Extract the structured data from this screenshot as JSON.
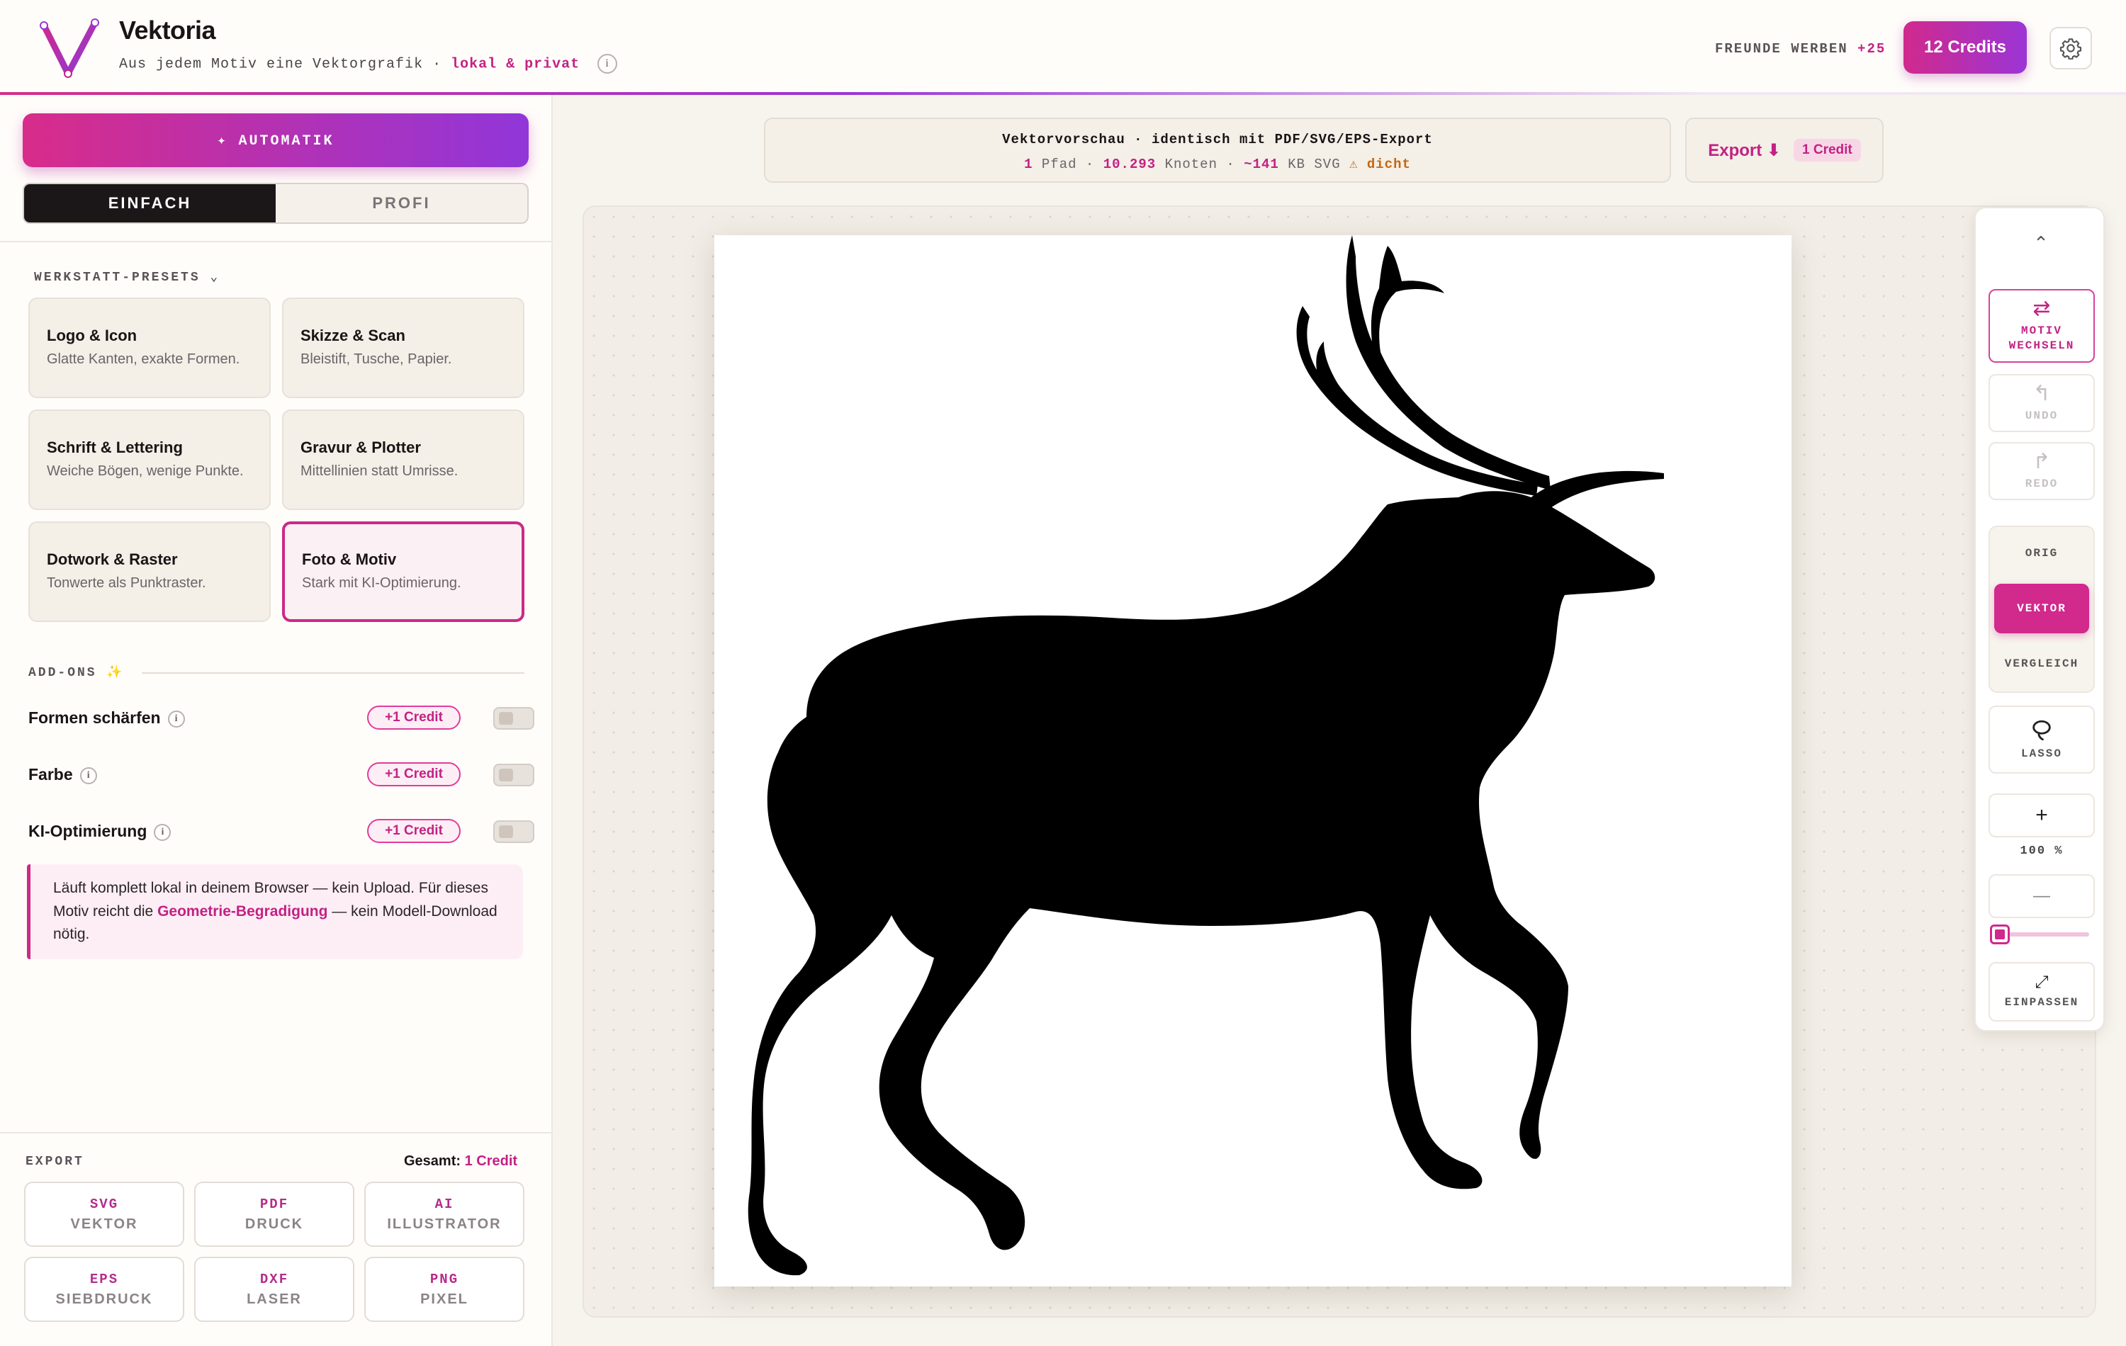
{
  "header": {
    "app_title": "Vektoria",
    "subtitle_prefix": "Aus jedem Motiv eine Vektorgrafik ·",
    "subtitle_accent": "lokal & privat",
    "info_icon": "i",
    "referral_label": "FREUNDE WERBEN",
    "referral_bonus": "+25",
    "credits_label": "12 Credits",
    "settings_icon": "gear-icon"
  },
  "sidebar": {
    "auto_label": "✦ AUTOMATIK",
    "modes": [
      "EINFACH",
      "PROFI"
    ],
    "active_mode": "EINFACH",
    "presets_label": "WERKSTATT-PRESETS ⌄",
    "presets": [
      {
        "title": "Logo & Icon",
        "desc": "Glatte Kanten, exakte Formen."
      },
      {
        "title": "Skizze & Scan",
        "desc": "Bleistift, Tusche, Papier."
      },
      {
        "title": "Schrift & Lettering",
        "desc": "Weiche Bögen, wenige Punkte."
      },
      {
        "title": "Gravur & Plotter",
        "desc": "Mittellinien statt Umrisse."
      },
      {
        "title": "Dotwork & Raster",
        "desc": "Tonwerte als Punktraster."
      },
      {
        "title": "Foto & Motiv",
        "desc": "Stark mit KI-Optimierung."
      }
    ],
    "active_preset": "Foto & Motiv",
    "addons_label": "ADD-ONS ✨",
    "addons": [
      {
        "name": "Formen schärfen",
        "badge": "+1 Credit",
        "enabled": false
      },
      {
        "name": "Farbe",
        "badge": "+1 Credit",
        "enabled": false
      },
      {
        "name": "KI-Optimierung",
        "badge": "+1 Credit",
        "enabled": false
      }
    ],
    "note": {
      "before": "Läuft komplett lokal in deinem Browser — kein Upload. Für dieses Motiv reicht die",
      "link": "Geometrie-Begradigung",
      "after": "— kein Modell-Download nötig."
    },
    "export": {
      "label": "EXPORT",
      "total_prefix": "Gesamt:",
      "total_value": "1 Credit",
      "formats": [
        {
          "code": "SVG",
          "label": "VEKTOR"
        },
        {
          "code": "PDF",
          "label": "DRUCK"
        },
        {
          "code": "AI",
          "label": "ILLUSTRATOR"
        },
        {
          "code": "EPS",
          "label": "SIEBDRUCK"
        },
        {
          "code": "DXF",
          "label": "LASER"
        },
        {
          "code": "PNG",
          "label": "PIXEL"
        }
      ]
    }
  },
  "preview": {
    "title": "Vektorvorschau · identisch mit PDF/SVG/EPS-Export",
    "paths_value": "1",
    "paths_label": "Pfad ·",
    "nodes_value": "10.293",
    "nodes_label": "Knoten ·",
    "size_value": "~141",
    "size_label": "KB SVG",
    "warning": "⚠ dicht"
  },
  "export_button": {
    "label": "Export ⬇",
    "cost": "1 Credit"
  },
  "tools": {
    "collapse_icon": "⌃",
    "motif": {
      "icon": "⇄",
      "label": "MOTIV WECHSELN"
    },
    "undo": {
      "icon": "↰",
      "label": "UNDO"
    },
    "redo": {
      "icon": "↱",
      "label": "REDO"
    },
    "view_modes": [
      "ORIG",
      "VEKTOR",
      "VERGLEICH"
    ],
    "active_view": "VEKTOR",
    "lasso": {
      "icon": "lasso-icon",
      "label": "LASSO"
    },
    "zoom_in": "+",
    "zoom_value": "100 %",
    "zoom_out": "—",
    "zoom_slider_level": 0.0,
    "fit": {
      "icon": "⤢",
      "label": "EINPASSEN"
    }
  },
  "colors": {
    "accent": "#c32184",
    "gradient_start": "#d1298c",
    "gradient_end": "#9b35d6",
    "silhouette": "#000000"
  }
}
